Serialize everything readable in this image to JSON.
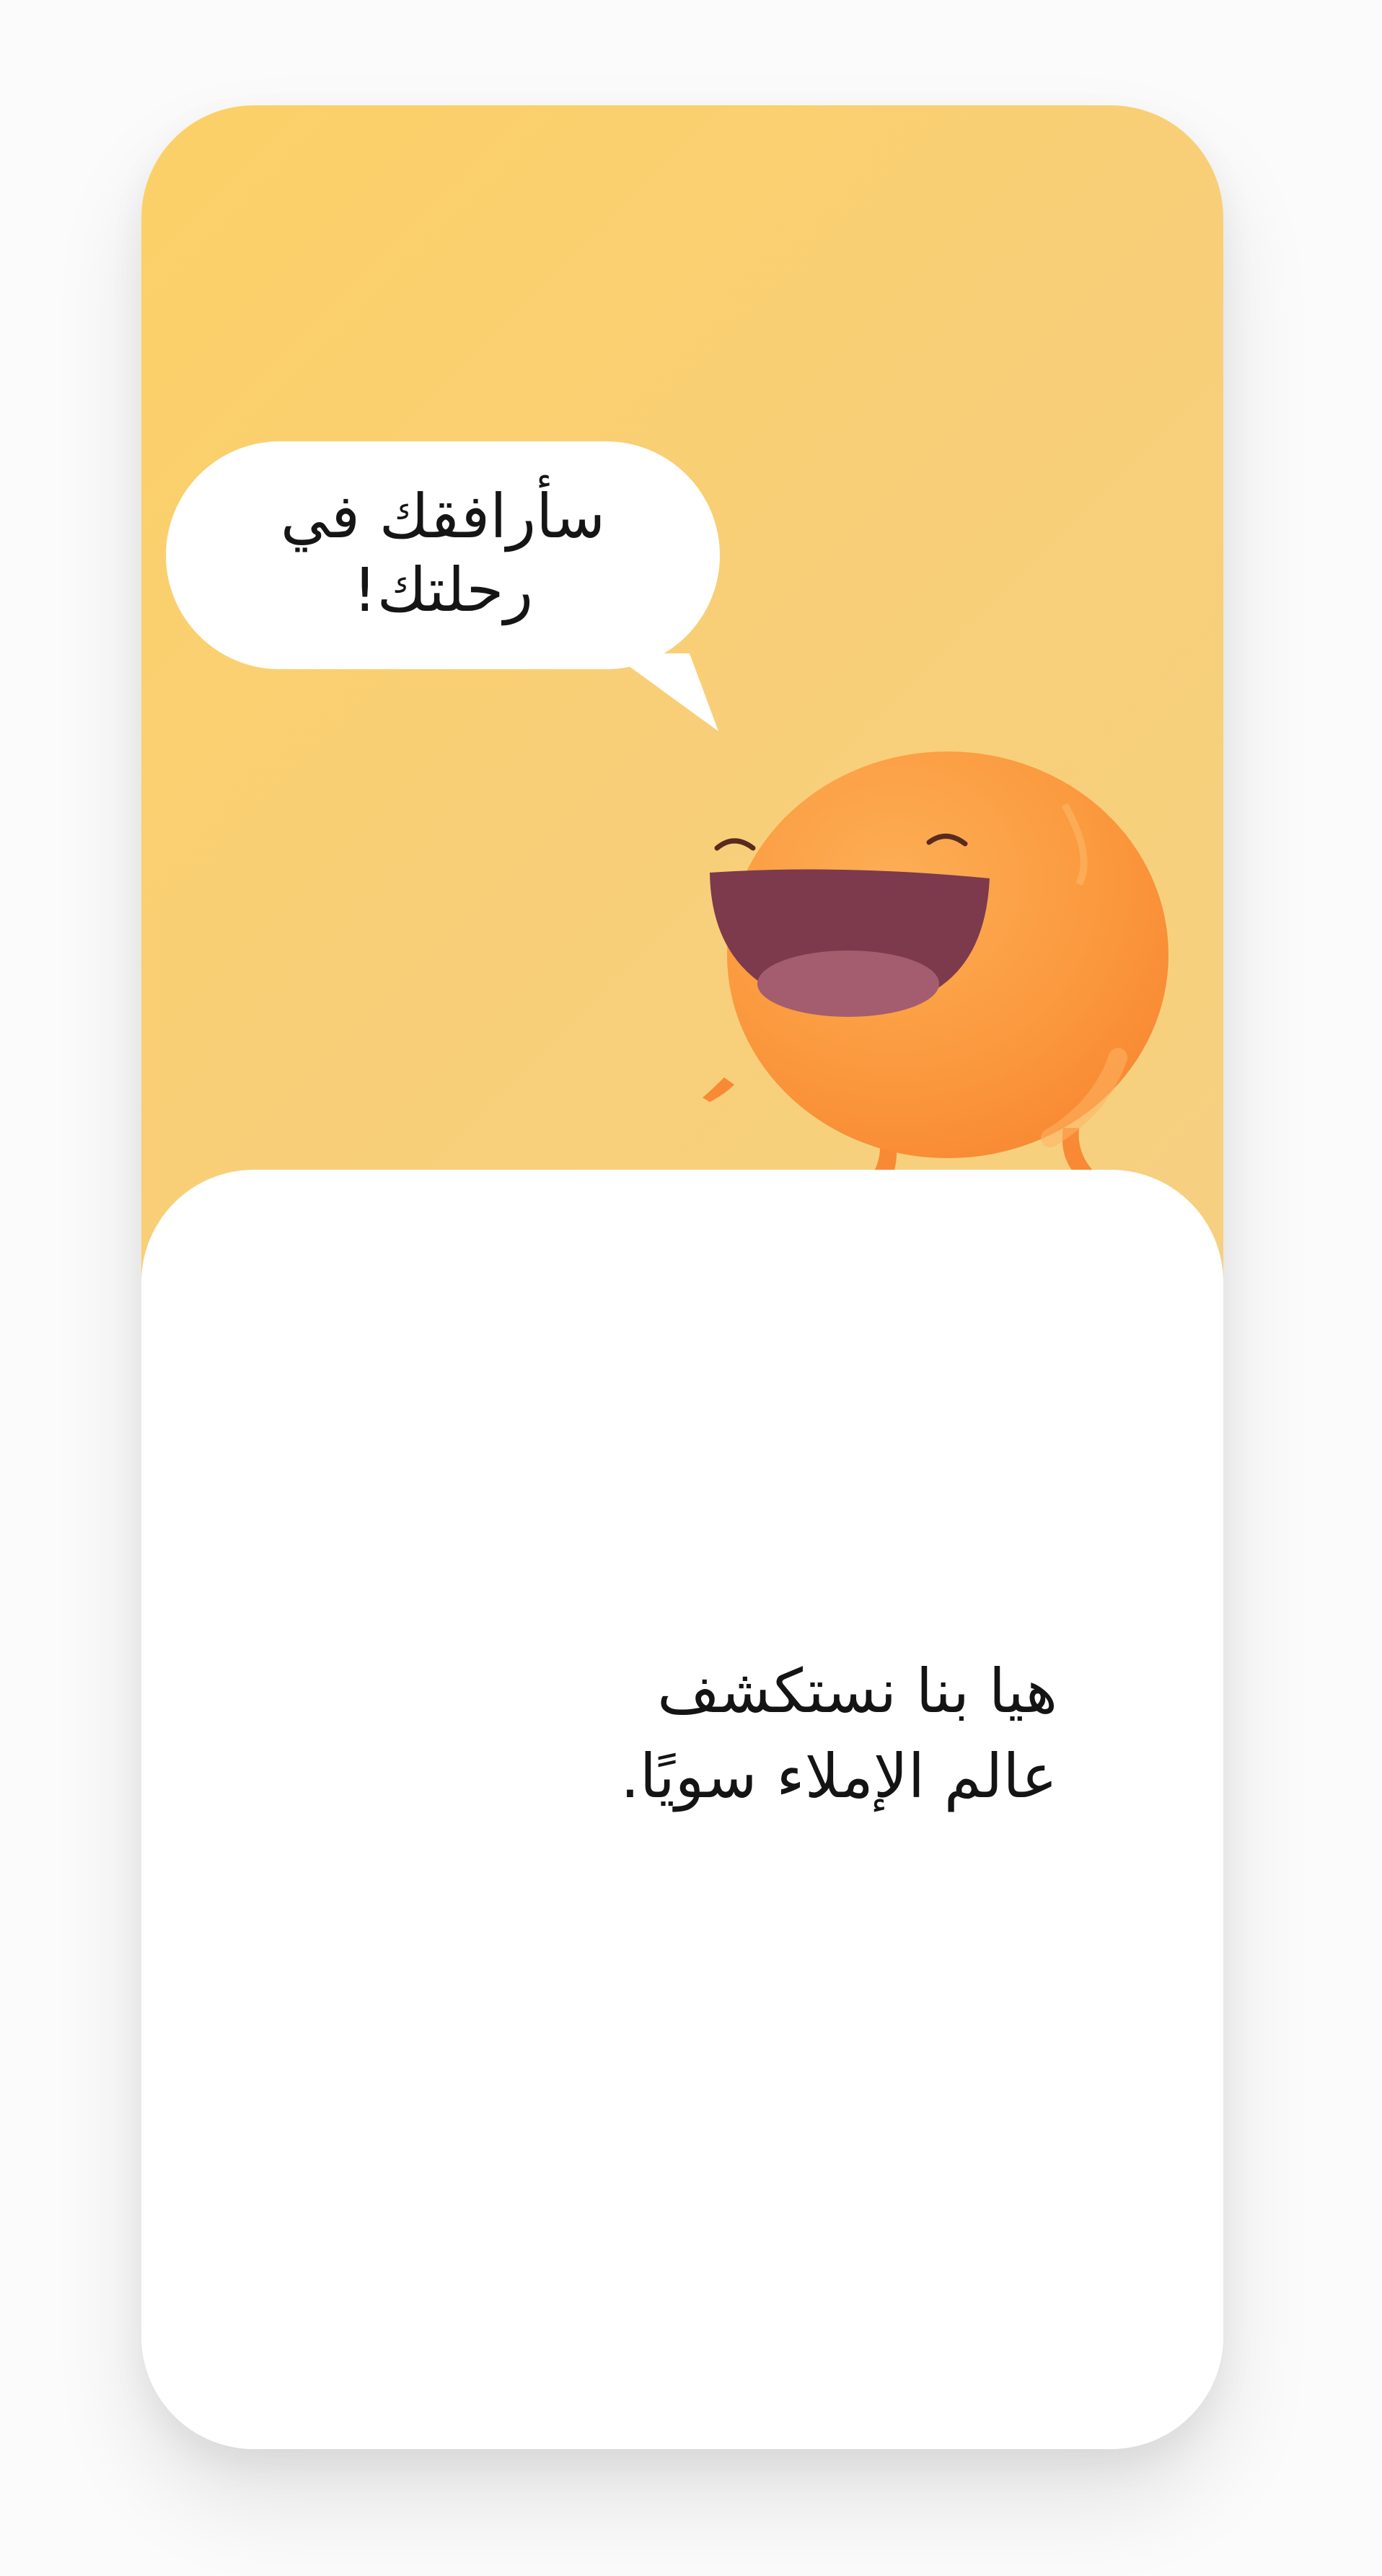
{
  "speech_bubble": {
    "line1": "سأرافقك في",
    "line2": "رحلتك!"
  },
  "intro_message": {
    "line1": "هيا بنا نستكشف",
    "line2": "عالم الإملاء سويًا."
  },
  "mascot": {
    "icon": "smiling-orange-mascot-icon"
  },
  "colors": {
    "hero_top": "#fcd067",
    "hero_bottom": "#f6d082",
    "mascot_body": "#fb9a3f",
    "mouth": "#7c3a4c",
    "card": "#ffffff"
  }
}
